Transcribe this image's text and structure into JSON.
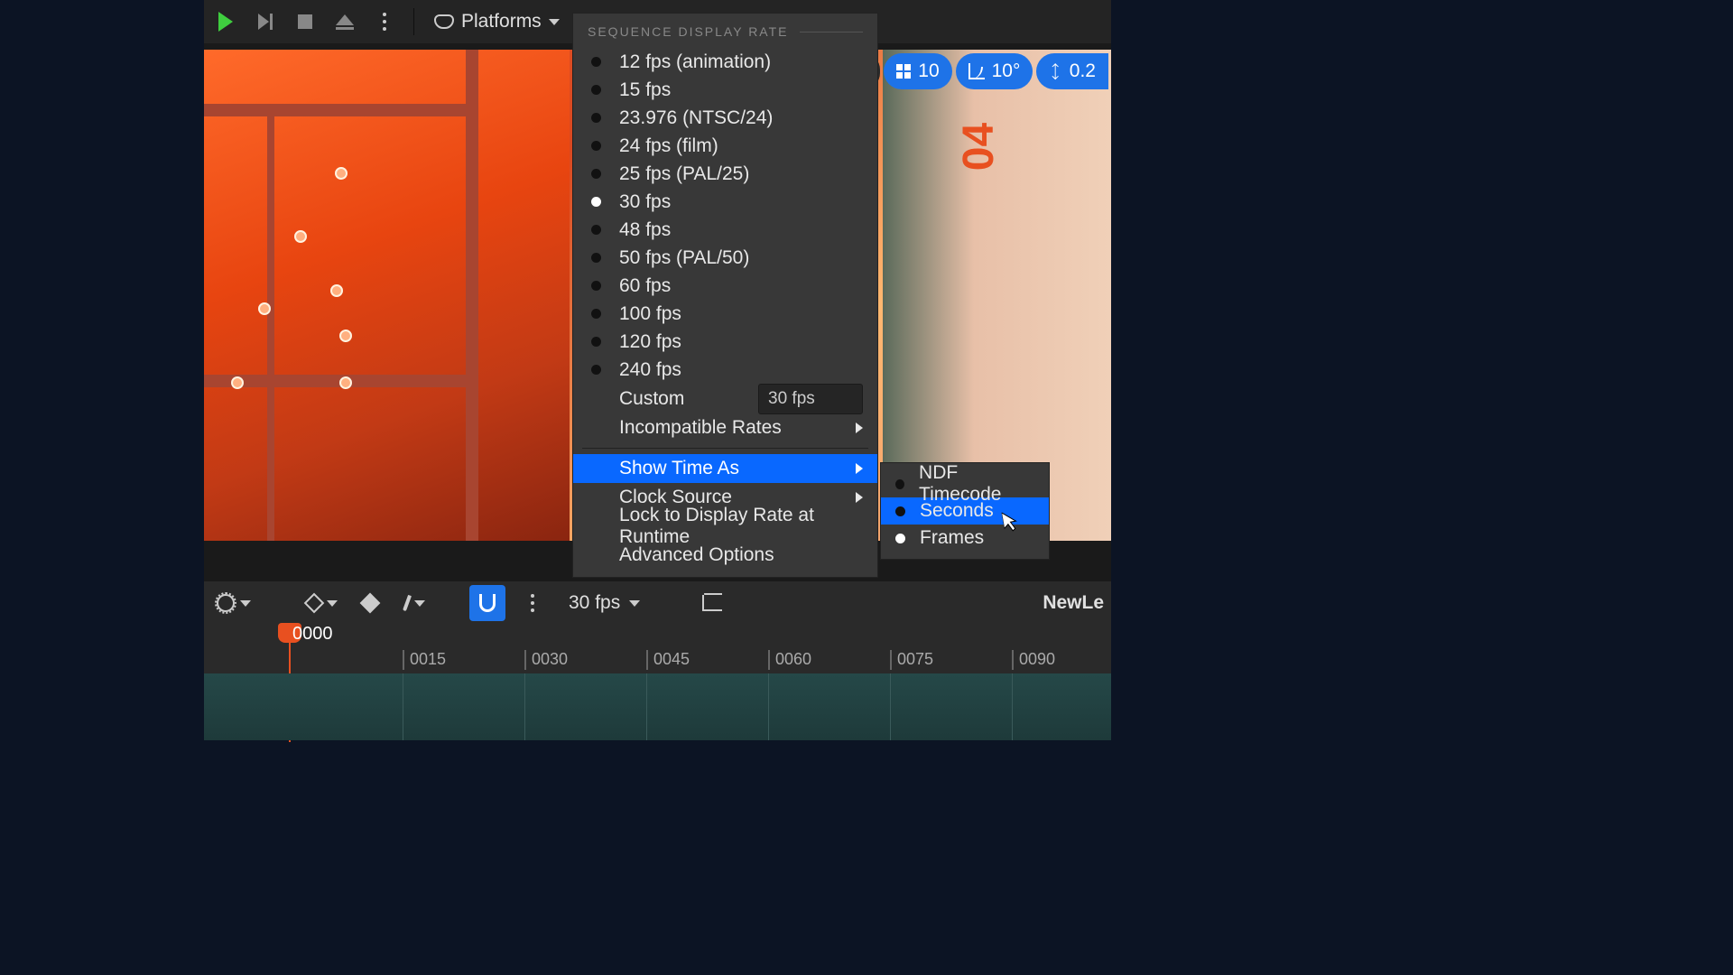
{
  "toolbar": {
    "platforms_label": "Platforms"
  },
  "viewport_pills": {
    "grid_value": "10",
    "angle_value": "10°",
    "scale_value": "0.2"
  },
  "menu": {
    "header": "SEQUENCE DISPLAY RATE",
    "rates": [
      {
        "label": "12 fps (animation)",
        "selected": false
      },
      {
        "label": "15 fps",
        "selected": false
      },
      {
        "label": "23.976 (NTSC/24)",
        "selected": false
      },
      {
        "label": "24 fps (film)",
        "selected": false
      },
      {
        "label": "25 fps (PAL/25)",
        "selected": false
      },
      {
        "label": "30 fps",
        "selected": true
      },
      {
        "label": "48 fps",
        "selected": false
      },
      {
        "label": "50 fps (PAL/50)",
        "selected": false
      },
      {
        "label": "60 fps",
        "selected": false
      },
      {
        "label": "100 fps",
        "selected": false
      },
      {
        "label": "120 fps",
        "selected": false
      },
      {
        "label": "240 fps",
        "selected": false
      }
    ],
    "custom_label": "Custom",
    "custom_value": "30 fps",
    "incompatible_label": "Incompatible Rates",
    "show_time_label": "Show Time As",
    "clock_source_label": "Clock Source",
    "lock_label": "Lock to Display Rate at Runtime",
    "advanced_label": "Advanced Options"
  },
  "submenu": {
    "items": [
      {
        "label": "NDF Timecode",
        "selected": false,
        "highlighted": false
      },
      {
        "label": "Seconds",
        "selected": false,
        "highlighted": true
      },
      {
        "label": "Frames",
        "selected": true,
        "highlighted": false
      }
    ]
  },
  "sequencer": {
    "fps_label": "30 fps",
    "sequence_name": "NewLe"
  },
  "timeline": {
    "playhead_label": "0000",
    "ticks": [
      "0015",
      "0030",
      "0045",
      "0060",
      "0075",
      "0090"
    ]
  },
  "viewport": {
    "decal_text": "04"
  }
}
